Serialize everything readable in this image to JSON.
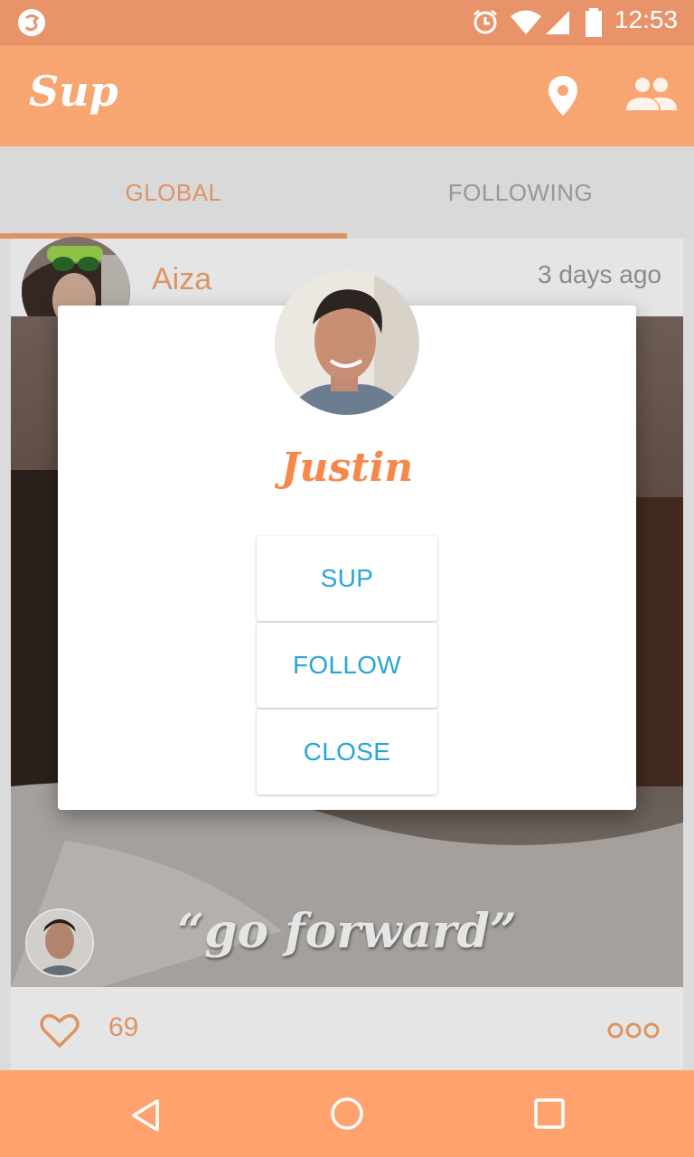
{
  "status_bar": {
    "time": "12:53",
    "icons": [
      "app-notification-icon",
      "alarm-icon",
      "wifi-icon",
      "cell-signal-icon",
      "battery-icon"
    ]
  },
  "app_bar": {
    "title": "Sup",
    "actions": [
      "location-pin-icon",
      "people-icon"
    ]
  },
  "tabs": [
    {
      "label": "GLOBAL",
      "active": true
    },
    {
      "label": "FOLLOWING",
      "active": false
    }
  ],
  "post": {
    "user": "Aiza",
    "time": "3 days ago",
    "caption": "“go forward”",
    "likes": "69"
  },
  "dialog": {
    "name": "Justin",
    "buttons": {
      "sup": "SUP",
      "follow": "FOLLOW",
      "close": "CLOSE"
    }
  },
  "nav_bar": [
    "back-icon",
    "home-icon",
    "recents-icon"
  ],
  "colors": {
    "primary": "#f7a571",
    "status_bar": "#e8936a",
    "accent_name": "#f7884c",
    "button_text": "#2aa3d8",
    "nav_bar": "#ffa26d"
  }
}
